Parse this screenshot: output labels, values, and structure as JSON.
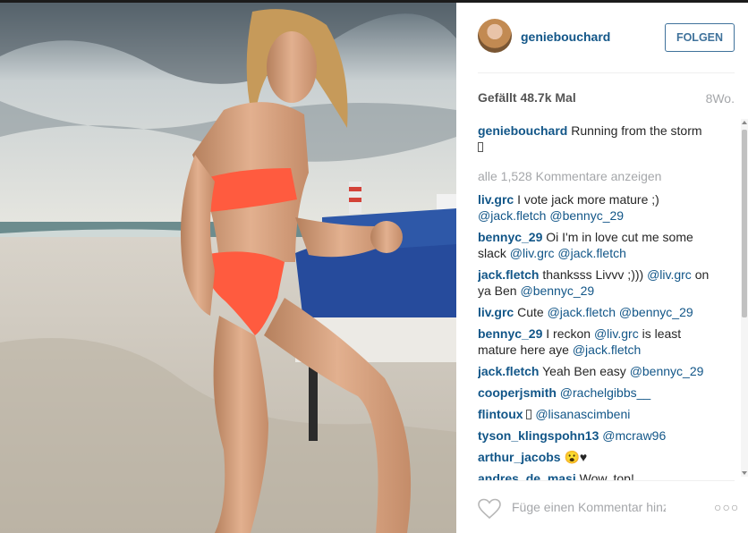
{
  "post": {
    "username": "geniebouchard",
    "follow_label": "FOLGEN",
    "likes": "Gefällt 48.7k Mal",
    "age": "8Wo.",
    "caption_user": "geniebouchard",
    "caption_text": "Running from the storm",
    "load_more": "alle 1,528 Kommentare anzeigen"
  },
  "comments": [
    {
      "user": "liv.grc",
      "parts": [
        {
          "t": "I vote jack more mature ;) "
        },
        {
          "m": "@jack.fletch"
        },
        {
          "t": " "
        },
        {
          "m": "@bennyc_29"
        }
      ]
    },
    {
      "user": "bennyc_29",
      "parts": [
        {
          "t": "Oi I'm in love cut me some slack "
        },
        {
          "m": "@liv.grc"
        },
        {
          "t": " "
        },
        {
          "m": "@jack.fletch"
        }
      ]
    },
    {
      "user": "jack.fletch",
      "parts": [
        {
          "t": "thanksss Livvv ;))) "
        },
        {
          "m": "@liv.grc"
        },
        {
          "t": " on ya Ben "
        },
        {
          "m": "@bennyc_29"
        }
      ]
    },
    {
      "user": "liv.grc",
      "parts": [
        {
          "t": "Cute "
        },
        {
          "m": "@jack.fletch"
        },
        {
          "t": " "
        },
        {
          "m": "@bennyc_29"
        }
      ]
    },
    {
      "user": "bennyc_29",
      "parts": [
        {
          "t": "I reckon "
        },
        {
          "m": "@liv.grc"
        },
        {
          "t": " is least mature here aye "
        },
        {
          "m": "@jack.fletch"
        }
      ]
    },
    {
      "user": "jack.fletch",
      "parts": [
        {
          "t": "Yeah Ben easy "
        },
        {
          "m": "@bennyc_29"
        }
      ]
    },
    {
      "user": "cooperjsmith",
      "parts": [
        {
          "m": "@rachelgibbs__"
        }
      ]
    },
    {
      "user": "flintoux",
      "parts": [
        {
          "box": true
        },
        {
          "t": " "
        },
        {
          "m": "@lisanascimbeni"
        }
      ]
    },
    {
      "user": "tyson_klingspohn13",
      "parts": [
        {
          "m": "@mcraw96"
        }
      ]
    },
    {
      "user": "arthur_jacobs",
      "parts": [
        {
          "t": "😮♥"
        }
      ]
    },
    {
      "user": "andres_de_masi",
      "parts": [
        {
          "t": "Wow, top!"
        }
      ]
    }
  ],
  "footer": {
    "comment_placeholder": "Füge einen Kommentar hinzu ...",
    "more_label": "○○○"
  },
  "colors": {
    "link": "#125688",
    "follow": "#3f729b",
    "muted": "#a5a7aa"
  },
  "icons": {
    "like": "heart-outline-icon",
    "more": "more-dots-icon"
  }
}
